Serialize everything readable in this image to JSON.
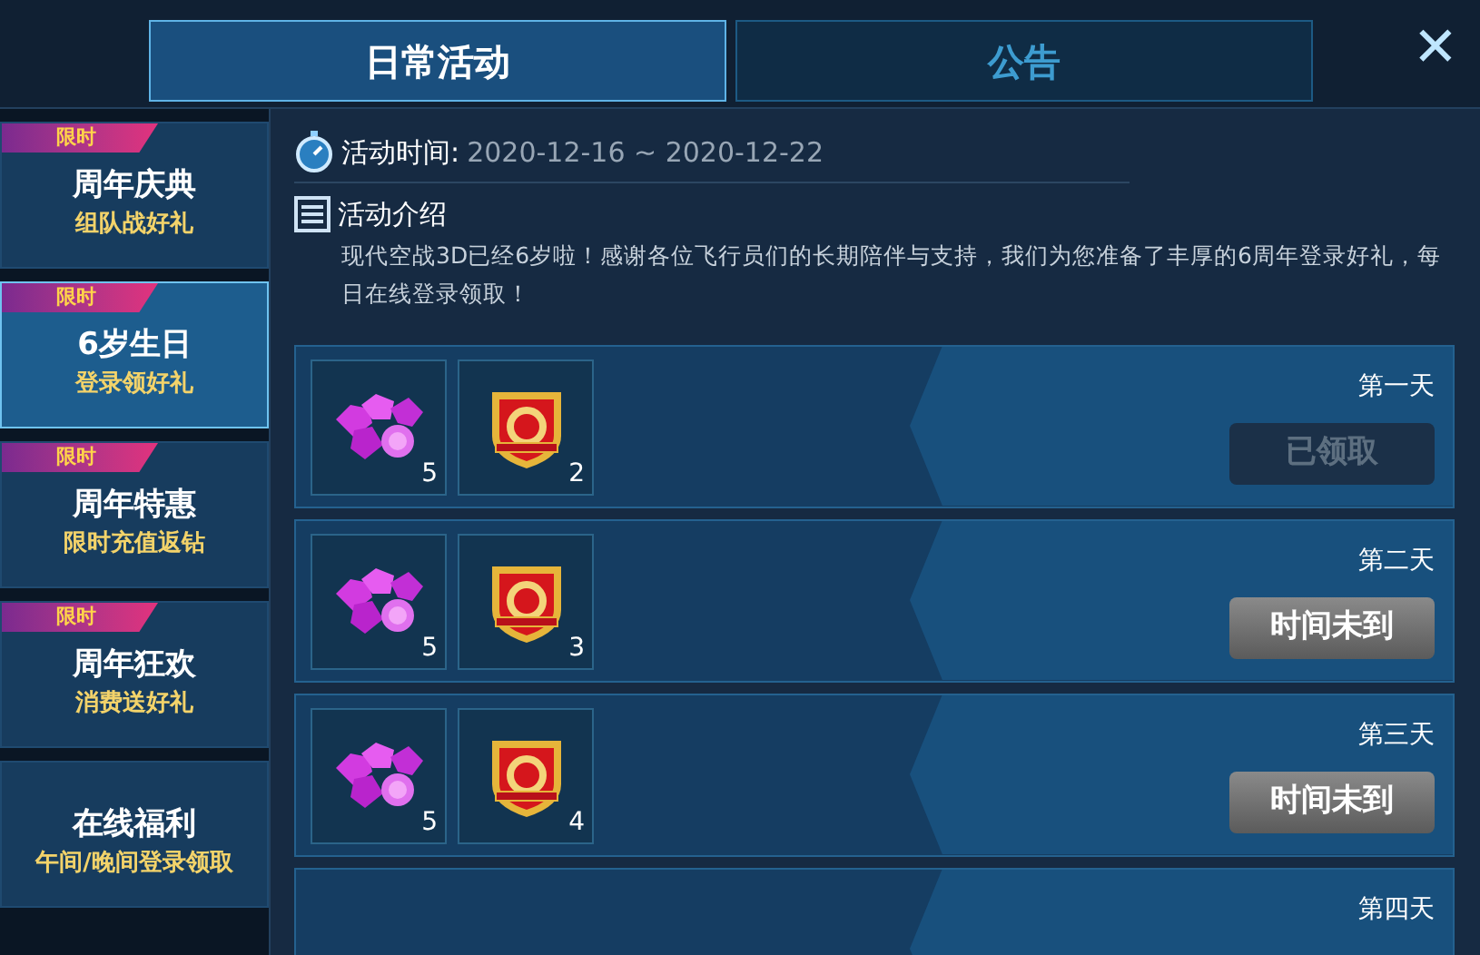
{
  "tabs": [
    {
      "label": "日常活动",
      "selected": true
    },
    {
      "label": "公告",
      "selected": false
    }
  ],
  "close": "✕",
  "sidebar": {
    "items": [
      {
        "tag": "限时",
        "title": "周年庆典",
        "subtitle": "组队战好礼",
        "selected": false
      },
      {
        "tag": "限时",
        "title": "6岁生日",
        "subtitle": "登录领好礼",
        "selected": true
      },
      {
        "tag": "限时",
        "title": "周年特惠",
        "subtitle": "限时充值返钻",
        "selected": false
      },
      {
        "tag": "限时",
        "title": "周年狂欢",
        "subtitle": "消费送好礼",
        "selected": false
      },
      {
        "title": "在线福利",
        "subtitle": "午间/晚间登录领取",
        "selected": false
      }
    ]
  },
  "info": {
    "time_label": "活动时间:",
    "time_value": "2020-12-16 ~ 2020-12-22",
    "intro_label": "活动介绍",
    "intro_text": "现代空战3D已经6岁啦！感谢各位飞行员们的长期陪伴与支持，我们为您准备了丰厚的6周年登录好礼，每日在线登录领取！"
  },
  "rewards": [
    {
      "day": "第一天",
      "items": [
        {
          "kind": "gem",
          "count": "5"
        },
        {
          "kind": "badge",
          "count": "2"
        }
      ],
      "button": {
        "kind": "claimed",
        "label": "已领取"
      }
    },
    {
      "day": "第二天",
      "items": [
        {
          "kind": "gem",
          "count": "5"
        },
        {
          "kind": "badge",
          "count": "3"
        }
      ],
      "button": {
        "kind": "locked",
        "label": "时间未到"
      }
    },
    {
      "day": "第三天",
      "items": [
        {
          "kind": "gem",
          "count": "5"
        },
        {
          "kind": "badge",
          "count": "4"
        }
      ],
      "button": {
        "kind": "locked",
        "label": "时间未到"
      }
    },
    {
      "day": "第四天"
    }
  ]
}
